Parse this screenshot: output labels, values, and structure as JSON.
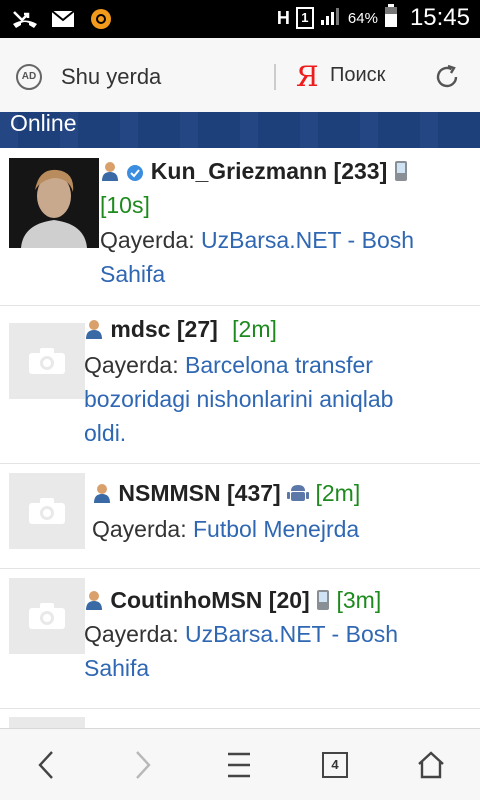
{
  "status_bar": {
    "battery": "64%",
    "time": "15:45",
    "sim_slot": "1",
    "net_letter": "H",
    "icons": [
      "missed-call-icon",
      "mail-icon",
      "notification-icon",
      "signal-icon",
      "battery-icon"
    ]
  },
  "browser": {
    "address_text": "Shu yerda",
    "search_logo": "Я",
    "search_label": "Поиск",
    "ad_badge": "AD"
  },
  "section": {
    "title": "Online"
  },
  "users": [
    {
      "name": "Kun_Griezmann [233]",
      "time": "[10s]",
      "where_label": "Qayerda:",
      "location_line1": "UzBarsa.NET - Bosh",
      "location_line2": "Sahifa",
      "device": "phone",
      "verified": true
    },
    {
      "name": "mdsc [27]",
      "time": "[2m]",
      "where_label": "Qayerda:",
      "location_line1": "Barcelona transfer",
      "location_line2": "bozoridagi nishonlarini aniqlab",
      "location_line3": "oldi."
    },
    {
      "name": "NSMMSN [437]",
      "time": "[2m]",
      "where_label": "Qayerda:",
      "location_line1": "Futbol Menejrda",
      "device": "android"
    },
    {
      "name": "CoutinhoMSN [20]",
      "time": "[3m]",
      "where_label": "Qayerda:",
      "location_line1": "UzBarsa.NET - Bosh",
      "location_line2": "Sahifa",
      "device": "phone"
    }
  ],
  "navbar": {
    "tab_count": "4"
  },
  "colors": {
    "header_blue": "#1d3f7a",
    "link_blue": "#2f67b2",
    "time_green": "#1e8a1e",
    "yandex_red": "#ee1c1c"
  }
}
